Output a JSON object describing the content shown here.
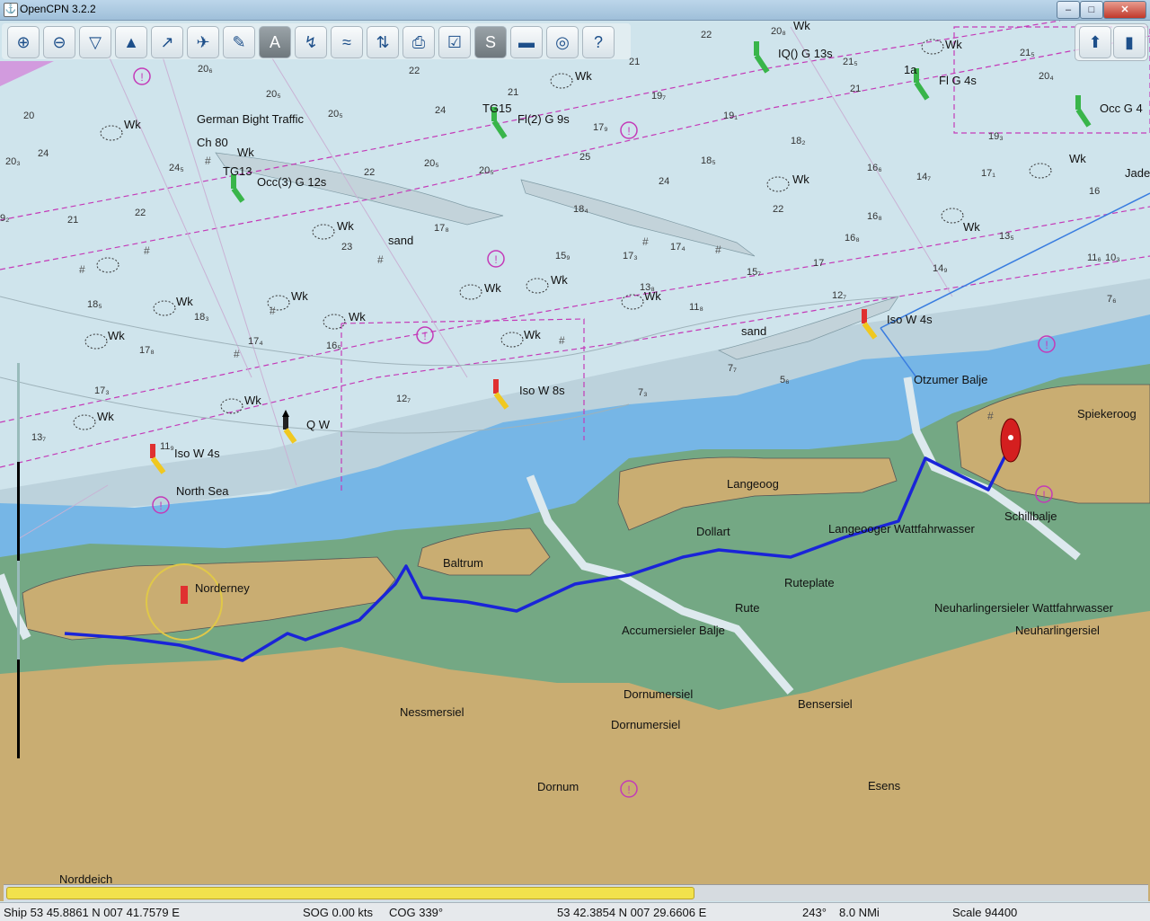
{
  "window": {
    "title": "OpenCPN 3.2.2",
    "min": "–",
    "max": "□",
    "close": "✕"
  },
  "toolbar": {
    "icons": [
      "zoom-in-icon",
      "zoom-out-icon",
      "chart-quilt-icon",
      "compass-icon",
      "route-icon",
      "ais-icon",
      "measure-icon",
      "text-icon",
      "waypoint-icon",
      "tide-icon",
      "current-icon",
      "print-icon",
      "settings-icon",
      "track-icon",
      "color-scheme-icon",
      "mob-icon",
      "help-icon"
    ],
    "glyphs": [
      "⊕",
      "⊖",
      "▽",
      "▲",
      "↗",
      "✈",
      "✎",
      "A",
      "↯",
      "≈",
      "⇅",
      "⎙",
      "☑",
      "S",
      "▬",
      "◎",
      "?"
    ]
  },
  "status": {
    "ship_position": "Ship 53 45.8861 N   007 41.7579 E",
    "sog": "SOG 0.00 kts",
    "cog": "COG 339°",
    "cursor_position": "53 42.3854 N   007 29.6606 E",
    "bearing": "243°",
    "distance": "8.0 NMi",
    "scale": "Scale 94400"
  },
  "progress": {
    "fraction": 0.6
  },
  "chart_labels": {
    "german_bight": "German Bight Traffic",
    "ch80": "Ch 80",
    "tg13": "TG13",
    "tg13_light": "Occ(3) G 12s",
    "tg15": "TG15",
    "tg15_light": "Fl(2) G 9s",
    "iq_light": "IQ() G 13s",
    "fl_light": "Fl G 4s",
    "occ_light": "Occ G 4",
    "jade": "Jade",
    "sand1": "sand",
    "sand2": "sand",
    "iso_w_8s": "Iso W 8s",
    "iso_w_4s_west": "Iso W 4s",
    "iso_w_4s_east": "Iso W 4s",
    "q_w": "Q W",
    "north_sea": "North Sea",
    "otzumer": "Otzumer Balje",
    "spiekeroog": "Spiekeroog",
    "langeoog": "Langeoog",
    "schillbalje": "Schillbalje",
    "dollart": "Dollart",
    "langeooger_wf": "Langeooger Wattfahrwasser",
    "baltrum": "Baltrum",
    "norderney": "Norderney",
    "ruteplate": "Ruteplate",
    "rute": "Rute",
    "neuharl_wf": "Neuharlingersieler Wattfahrwasser",
    "neuharlingersiel": "Neuharlingersiel",
    "accumersieler": "Accumersieler Balje",
    "dornumersiel1": "Dornumersiel",
    "dornumersiel2": "Dornumersiel",
    "bensersiel": "Bensersiel",
    "nessmersiel": "Nessmersiel",
    "dornum": "Dornum",
    "esens": "Esens",
    "norddeich": "Norddeich",
    "wk": "Wk",
    "tag_1a": "1a"
  },
  "colors": {
    "deep_water": "#cfe4ec",
    "shallow_water": "#74b4e4",
    "mud_flats": "#74a884",
    "land": "#c9ad72",
    "route": "#1a24d8",
    "traffic_lines": "#c43ab8"
  }
}
